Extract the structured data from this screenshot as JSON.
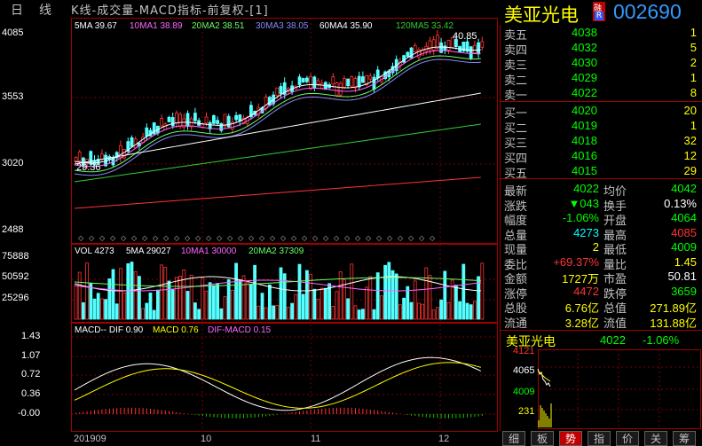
{
  "top": {
    "period_day": "日",
    "period_line": "线",
    "chart_title": "K线-成交量-MACD指标-前复权-[1]"
  },
  "stock": {
    "name": "美亚光电",
    "badge_top": "融",
    "badge_bottom": "R",
    "code": "002690"
  },
  "ma_legend": [
    {
      "label": "5MA 39.67",
      "color": "#ffffff"
    },
    {
      "label": "10MA1 38.89",
      "color": "#ff66ff"
    },
    {
      "label": "20MA2 38.51",
      "color": "#66ff66"
    },
    {
      "label": "30MA3 38.05",
      "color": "#8888ff"
    },
    {
      "label": "60MA4 35.90",
      "color": "#ffffff"
    },
    {
      "label": "120MA5 33.42",
      "color": "#33cc33"
    }
  ],
  "price_axis": [
    "4085",
    "3553",
    "3020",
    "2488"
  ],
  "price_high_label": "40.85",
  "price_low_label": "29.36",
  "vol_legend": [
    {
      "label": "VOL 4273",
      "color": "#ffffff"
    },
    {
      "label": "5MA 29027",
      "color": "#ffffff"
    },
    {
      "label": "10MA1 30000",
      "color": "#ff66ff"
    },
    {
      "label": "20MA2 37309",
      "color": "#66ff66"
    }
  ],
  "vol_axis": [
    "75888",
    "50592",
    "25296"
  ],
  "macd_legend": [
    {
      "label": "MACD-- DIF 0.90",
      "color": "#ffffff"
    },
    {
      "label": "MACD 0.76",
      "color": "#ffff00"
    },
    {
      "label": "DIF-MACD 0.15",
      "color": "#ff66ff"
    }
  ],
  "macd_axis": [
    "1.43",
    "1.07",
    "0.72",
    "0.36",
    "-0.00"
  ],
  "x_axis": [
    "201909",
    "10",
    "11",
    "12"
  ],
  "orderbook": {
    "asks": [
      {
        "label": "卖五",
        "price": "4038",
        "vol": "1"
      },
      {
        "label": "卖四",
        "price": "4032",
        "vol": "5"
      },
      {
        "label": "卖三",
        "price": "4030",
        "vol": "2"
      },
      {
        "label": "卖二",
        "price": "4029",
        "vol": "1"
      },
      {
        "label": "卖一",
        "price": "4022",
        "vol": "8"
      }
    ],
    "bids": [
      {
        "label": "买一",
        "price": "4020",
        "vol": "20"
      },
      {
        "label": "买二",
        "price": "4019",
        "vol": "1"
      },
      {
        "label": "买三",
        "price": "4018",
        "vol": "32"
      },
      {
        "label": "买四",
        "price": "4016",
        "vol": "12"
      },
      {
        "label": "买五",
        "price": "4015",
        "vol": "29"
      }
    ]
  },
  "stats": [
    {
      "l1": "最新",
      "v1": "4022",
      "c1": "#00ff00",
      "l2": "均价",
      "v2": "4042",
      "c2": "#00ff00"
    },
    {
      "l1": "涨跌",
      "v1": "▼043",
      "c1": "#00ff00",
      "l2": "换手",
      "v2": "0.13%",
      "c2": "#ffffff"
    },
    {
      "l1": "幅度",
      "v1": "-1.06%",
      "c1": "#00ff00",
      "l2": "开盘",
      "v2": "4064",
      "c2": "#00ff00"
    },
    {
      "l1": "总量",
      "v1": "4273",
      "c1": "#00ffff",
      "l2": "最高",
      "v2": "4085",
      "c2": "#ff3333"
    },
    {
      "l1": "现量",
      "v1": "2",
      "c1": "#ffff00",
      "l2": "最低",
      "v2": "4009",
      "c2": "#00ff00"
    },
    {
      "l1": "委比",
      "v1": "+69.37%",
      "c1": "#ff3333",
      "l2": "量比",
      "v2": "1.45",
      "c2": "#ffff00"
    },
    {
      "l1": "金额",
      "v1": "1727万",
      "c1": "#ffff00",
      "l2": "市盈",
      "v2": "50.81",
      "c2": "#ffffff"
    },
    {
      "l1": "涨停",
      "v1": "4472",
      "c1": "#ff3333",
      "l2": "跌停",
      "v2": "3659",
      "c2": "#00ff00"
    },
    {
      "l1": "总股",
      "v1": "6.76亿",
      "c1": "#ffff00",
      "l2": "总值",
      "v2": "271.89亿",
      "c2": "#ffff00"
    },
    {
      "l1": "流通",
      "v1": "3.28亿",
      "c1": "#ffff00",
      "l2": "流值",
      "v2": "131.88亿",
      "c2": "#ffff00"
    }
  ],
  "mini": {
    "name": "美亚光电",
    "price": "4022",
    "change": "-1.06%",
    "axis_high": "4121",
    "axis_mid": "4065",
    "axis_low": "4009",
    "axis_vol": "231"
  },
  "bottom_tabs": [
    "细",
    "板",
    "势",
    "指",
    "价",
    "关",
    "筹"
  ],
  "active_tab": "势"
}
